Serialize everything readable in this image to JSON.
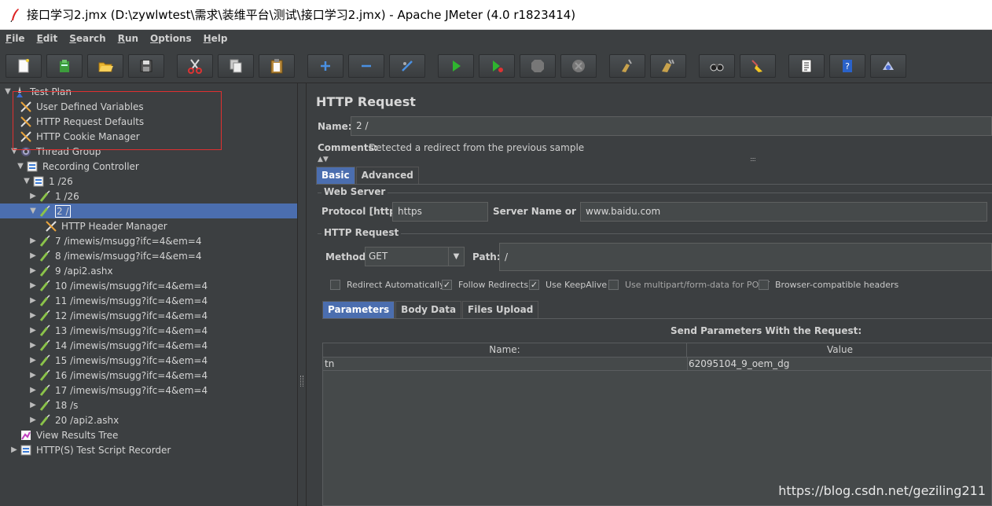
{
  "window": {
    "title": "接口学习2.jmx (D:\\zywlwtest\\需求\\装维平台\\测试\\接口学习2.jmx) - Apache JMeter (4.0 r1823414)"
  },
  "menu": [
    "File",
    "Edit",
    "Search",
    "Run",
    "Options",
    "Help"
  ],
  "toolbar": {
    "icons": [
      "new-icon",
      "templates-icon",
      "open-icon",
      "save-icon",
      "cut-icon",
      "copy-icon",
      "paste-icon",
      "expand-icon",
      "collapse-icon",
      "toggle-icon",
      "start-icon",
      "start-no-pause-icon",
      "stop-icon",
      "shutdown-icon",
      "clear-icon",
      "clear-all-icon",
      "search-icon",
      "reset-search-icon",
      "function-helper-icon",
      "help-icon",
      "remote-icon"
    ]
  },
  "tree": {
    "items": [
      {
        "label": "Test Plan",
        "depth": 0,
        "toggle": "▼",
        "icon": "test-plan-icon"
      },
      {
        "label": "User Defined Variables",
        "depth": 1,
        "toggle": "",
        "icon": "config-icon"
      },
      {
        "label": "HTTP Request Defaults",
        "depth": 1,
        "toggle": "",
        "icon": "config-icon"
      },
      {
        "label": "HTTP Cookie Manager",
        "depth": 1,
        "toggle": "",
        "icon": "config-icon"
      },
      {
        "label": "Thread Group",
        "depth": 1,
        "toggle": "▼",
        "icon": "thread-group-icon"
      },
      {
        "label": "Recording Controller",
        "depth": 2,
        "toggle": "▼",
        "icon": "controller-icon"
      },
      {
        "label": "1 /26",
        "depth": 3,
        "toggle": "▼",
        "icon": "controller-icon"
      },
      {
        "label": "1 /26",
        "depth": 4,
        "toggle": "▶",
        "icon": "sampler-icon"
      },
      {
        "label": "2 /",
        "depth": 4,
        "toggle": "▼",
        "icon": "sampler-icon",
        "selected": true
      },
      {
        "label": "HTTP Header Manager",
        "depth": 5,
        "toggle": "",
        "icon": "config-icon"
      },
      {
        "label": "7 /imewis/msugg?ifc=4&em=4",
        "depth": 4,
        "toggle": "▶",
        "icon": "sampler-icon"
      },
      {
        "label": "8 /imewis/msugg?ifc=4&em=4",
        "depth": 4,
        "toggle": "▶",
        "icon": "sampler-icon"
      },
      {
        "label": "9 /api2.ashx",
        "depth": 4,
        "toggle": "▶",
        "icon": "sampler-icon"
      },
      {
        "label": "10 /imewis/msugg?ifc=4&em=4",
        "depth": 4,
        "toggle": "▶",
        "icon": "sampler-icon"
      },
      {
        "label": "11 /imewis/msugg?ifc=4&em=4",
        "depth": 4,
        "toggle": "▶",
        "icon": "sampler-icon"
      },
      {
        "label": "12 /imewis/msugg?ifc=4&em=4",
        "depth": 4,
        "toggle": "▶",
        "icon": "sampler-icon"
      },
      {
        "label": "13 /imewis/msugg?ifc=4&em=4",
        "depth": 4,
        "toggle": "▶",
        "icon": "sampler-icon"
      },
      {
        "label": "14 /imewis/msugg?ifc=4&em=4",
        "depth": 4,
        "toggle": "▶",
        "icon": "sampler-icon"
      },
      {
        "label": "15 /imewis/msugg?ifc=4&em=4",
        "depth": 4,
        "toggle": "▶",
        "icon": "sampler-icon"
      },
      {
        "label": "16 /imewis/msugg?ifc=4&em=4",
        "depth": 4,
        "toggle": "▶",
        "icon": "sampler-icon"
      },
      {
        "label": "17 /imewis/msugg?ifc=4&em=4",
        "depth": 4,
        "toggle": "▶",
        "icon": "sampler-icon"
      },
      {
        "label": "18 /s",
        "depth": 4,
        "toggle": "▶",
        "icon": "sampler-icon"
      },
      {
        "label": "20 /api2.ashx",
        "depth": 4,
        "toggle": "▶",
        "icon": "sampler-icon"
      },
      {
        "label": "View Results Tree",
        "depth": 1,
        "toggle": "",
        "icon": "listener-icon"
      },
      {
        "label": "HTTP(S) Test Script Recorder",
        "depth": 1,
        "toggle": "▶",
        "icon": "controller-icon"
      }
    ]
  },
  "panel": {
    "title": "HTTP Request",
    "name_label": "Name:",
    "name_value": "2 /",
    "comments_label": "Comments:",
    "comments_value": "Detected a redirect from the previous sample",
    "tabs": [
      "Basic",
      "Advanced"
    ],
    "web_server": {
      "group_title": "Web Server",
      "protocol_label": "Protocol [http]:",
      "protocol_value": "https",
      "server_label": "Server Name or IP:",
      "server_value": "www.baidu.com"
    },
    "http_request": {
      "group_title": "HTTP Request",
      "method_label": "Method:",
      "method_value": "GET",
      "path_label": "Path:",
      "path_value": "/"
    },
    "checkboxes": [
      {
        "label": "Redirect Automatically",
        "checked": false
      },
      {
        "label": "Follow Redirects",
        "checked": true
      },
      {
        "label": "Use KeepAlive",
        "checked": true
      },
      {
        "label": "Use multipart/form-data for POST",
        "checked": false
      },
      {
        "label": "Browser-compatible headers",
        "checked": false
      }
    ],
    "sub_tabs": [
      "Parameters",
      "Body Data",
      "Files Upload"
    ],
    "params_title": "Send Parameters With the Request:",
    "params_columns": [
      "Name:",
      "Value"
    ],
    "params_rows": [
      {
        "name": "tn",
        "value": "62095104_9_oem_dg"
      }
    ]
  },
  "watermark": "https://blog.csdn.net/geziling211"
}
